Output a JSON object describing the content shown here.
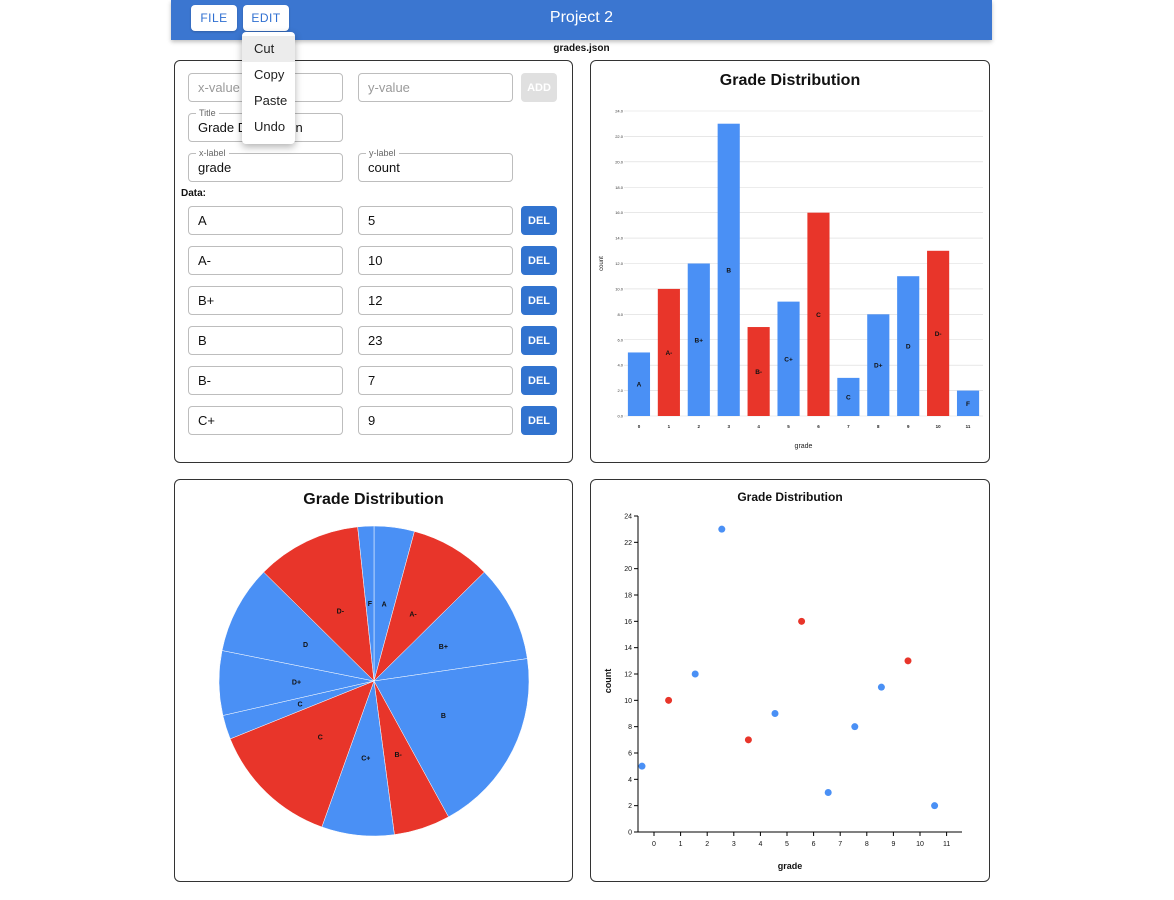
{
  "app": {
    "title": "Project 2",
    "filename": "grades.json",
    "file_label": "FILE",
    "edit_label": "EDIT"
  },
  "edit_menu": {
    "items": [
      "Cut",
      "Copy",
      "Paste",
      "Undo"
    ]
  },
  "form": {
    "x_placeholder": "x-value",
    "y_placeholder": "y-value",
    "add_label": "ADD",
    "title_legend": "Title",
    "title_value": "Grade Distribution",
    "xlabel_legend": "x-label",
    "xlabel_value": "grade",
    "ylabel_legend": "y-label",
    "ylabel_value": "count",
    "data_heading": "Data:",
    "del_label": "DEL",
    "rows": [
      {
        "x": "A",
        "y": "5"
      },
      {
        "x": "A-",
        "y": "10"
      },
      {
        "x": "B+",
        "y": "12"
      },
      {
        "x": "B",
        "y": "23"
      },
      {
        "x": "B-",
        "y": "7"
      },
      {
        "x": "C+",
        "y": "9"
      }
    ]
  },
  "colors": {
    "blue": "#4a90f5",
    "red": "#e8352a",
    "appbar": "#3b76d0"
  },
  "chart_data": [
    {
      "type": "bar",
      "title": "Grade Distribution",
      "xlabel": "grade",
      "ylabel": "count",
      "categories": [
        "A",
        "A-",
        "B+",
        "B",
        "B-",
        "C+",
        "C",
        "C",
        "D+",
        "D",
        "D-",
        "F"
      ],
      "x_ticks": [
        "0",
        "1",
        "2",
        "3",
        "4",
        "5",
        "6",
        "7",
        "8",
        "9",
        "10",
        "11"
      ],
      "values": [
        5,
        10,
        12,
        23,
        7,
        9,
        16,
        3,
        8,
        11,
        13,
        2
      ],
      "bar_colors": [
        "blue",
        "red",
        "blue",
        "blue",
        "red",
        "blue",
        "red",
        "blue",
        "blue",
        "blue",
        "red",
        "blue"
      ],
      "ylim": [
        0,
        24
      ],
      "y_ticks": [
        "0.0",
        "2.0",
        "4.0",
        "6.0",
        "8.0",
        "10.0",
        "12.0",
        "14.0",
        "16.0",
        "18.0",
        "20.0",
        "22.0",
        "24.0"
      ],
      "grid": true
    },
    {
      "type": "pie",
      "title": "Grade Distribution",
      "labels": [
        "A",
        "A-",
        "B+",
        "B",
        "B-",
        "C+",
        "C",
        "C",
        "D+",
        "D",
        "D-",
        "F"
      ],
      "values": [
        5,
        10,
        12,
        23,
        7,
        9,
        16,
        3,
        8,
        11,
        13,
        2
      ],
      "slice_colors": [
        "blue",
        "red",
        "blue",
        "blue",
        "red",
        "blue",
        "red",
        "blue",
        "blue",
        "blue",
        "red",
        "blue"
      ]
    },
    {
      "type": "scatter",
      "title": "Grade Distribution",
      "xlabel": "grade",
      "ylabel": "count",
      "x": [
        0,
        1,
        2,
        3,
        4,
        5,
        6,
        7,
        8,
        9,
        10,
        11
      ],
      "x_ticks": [
        "0",
        "1",
        "2",
        "3",
        "4",
        "5",
        "6",
        "7",
        "8",
        "9",
        "10",
        "11"
      ],
      "y": [
        5,
        10,
        12,
        23,
        7,
        9,
        16,
        3,
        8,
        11,
        13,
        2
      ],
      "point_colors": [
        "blue",
        "red",
        "blue",
        "blue",
        "red",
        "blue",
        "red",
        "blue",
        "blue",
        "blue",
        "red",
        "blue"
      ],
      "ylim": [
        0,
        24
      ],
      "y_ticks": [
        "0",
        "2",
        "4",
        "6",
        "8",
        "10",
        "12",
        "14",
        "16",
        "18",
        "20",
        "22",
        "24"
      ],
      "grid": false
    }
  ]
}
